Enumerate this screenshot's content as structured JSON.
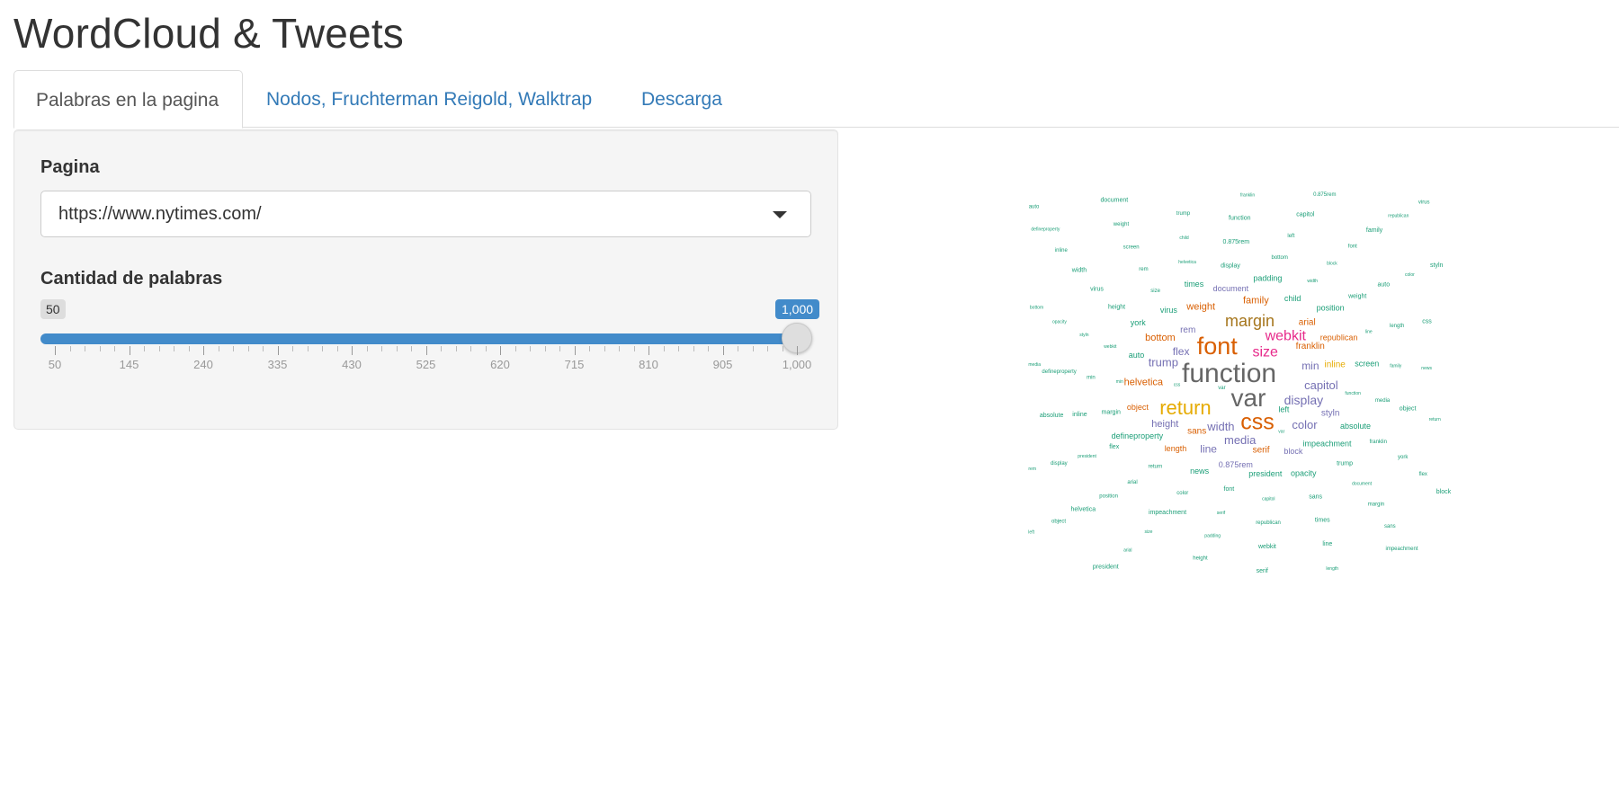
{
  "app": {
    "title": "WordCloud & Tweets"
  },
  "tabs": [
    {
      "label": "Palabras en la pagina"
    },
    {
      "label": "Nodos, Fruchterman Reigold, Walktrap"
    },
    {
      "label": "Descarga"
    }
  ],
  "controls": {
    "pagina": {
      "label": "Pagina",
      "value": "https://www.nytimes.com/"
    },
    "cantidad": {
      "label": "Cantidad de palabras",
      "min": "50",
      "max": "1,000",
      "value": 1000,
      "ticks": [
        "50",
        "145",
        "240",
        "335",
        "430",
        "525",
        "620",
        "715",
        "810",
        "905",
        "1,000"
      ]
    }
  },
  "wordcloud": {
    "words": [
      {
        "text": "function",
        "color": "#666666",
        "size": 30
      },
      {
        "text": "var",
        "color": "#666666",
        "size": 28
      },
      {
        "text": "font",
        "color": "#d95f02",
        "size": 27
      },
      {
        "text": "css",
        "color": "#d95f02",
        "size": 25
      },
      {
        "text": "return",
        "color": "#e6ab02",
        "size": 22
      },
      {
        "text": "margin",
        "color": "#a6761d",
        "size": 18
      },
      {
        "text": "webkit",
        "color": "#e7298a",
        "size": 16
      },
      {
        "text": "size",
        "color": "#e7298a",
        "size": 16
      },
      {
        "text": "display",
        "color": "#7570b3",
        "size": 14
      },
      {
        "text": "width",
        "color": "#7570b3",
        "size": 13
      },
      {
        "text": "media",
        "color": "#7570b3",
        "size": 13
      },
      {
        "text": "trump",
        "color": "#7570b3",
        "size": 13
      },
      {
        "text": "capitol",
        "color": "#7570b3",
        "size": 13
      },
      {
        "text": "color",
        "color": "#7570b3",
        "size": 13
      },
      {
        "text": "flex",
        "color": "#7570b3",
        "size": 12
      },
      {
        "text": "line",
        "color": "#7570b3",
        "size": 12
      },
      {
        "text": "min",
        "color": "#7570b3",
        "size": 12
      },
      {
        "text": "height",
        "color": "#7570b3",
        "size": 11
      },
      {
        "text": "helvetica",
        "color": "#d95f02",
        "size": 11
      },
      {
        "text": "bottom",
        "color": "#d95f02",
        "size": 11
      },
      {
        "text": "weight",
        "color": "#d95f02",
        "size": 11
      },
      {
        "text": "family",
        "color": "#d95f02",
        "size": 11
      },
      {
        "text": "franklin",
        "color": "#d95f02",
        "size": 10
      },
      {
        "text": "sans",
        "color": "#d95f02",
        "size": 10
      },
      {
        "text": "serif",
        "color": "#d95f02",
        "size": 10
      },
      {
        "text": "arial",
        "color": "#d95f02",
        "size": 10
      },
      {
        "text": "inline",
        "color": "#e6ab02",
        "size": 10
      },
      {
        "text": "styln",
        "color": "#7570b3",
        "size": 10
      },
      {
        "text": "rem",
        "color": "#7570b3",
        "size": 10
      },
      {
        "text": "0.875rem",
        "color": "#7570b3",
        "size": 9
      },
      {
        "text": "block",
        "color": "#7570b3",
        "size": 9
      },
      {
        "text": "length",
        "color": "#d95f02",
        "size": 9
      },
      {
        "text": "object",
        "color": "#d95f02",
        "size": 9
      },
      {
        "text": "document",
        "color": "#7570b3",
        "size": 9
      },
      {
        "text": "republican",
        "color": "#d95f02",
        "size": 9
      },
      {
        "text": "impeachment",
        "color": "#1b9e77",
        "size": 9
      },
      {
        "text": "president",
        "color": "#1b9e77",
        "size": 9
      },
      {
        "text": "defineproperty",
        "color": "#1b9e77",
        "size": 9
      },
      {
        "text": "virus",
        "color": "#1b9e77",
        "size": 9
      },
      {
        "text": "child",
        "color": "#1b9e77",
        "size": 9
      },
      {
        "text": "left",
        "color": "#1b9e77",
        "size": 9
      },
      {
        "text": "auto",
        "color": "#1b9e77",
        "size": 9
      },
      {
        "text": "news",
        "color": "#1b9e77",
        "size": 9
      },
      {
        "text": "york",
        "color": "#1b9e77",
        "size": 9
      },
      {
        "text": "times",
        "color": "#1b9e77",
        "size": 9
      },
      {
        "text": "padding",
        "color": "#1b9e77",
        "size": 9
      },
      {
        "text": "position",
        "color": "#1b9e77",
        "size": 9
      },
      {
        "text": "absolute",
        "color": "#1b9e77",
        "size": 9
      },
      {
        "text": "opacity",
        "color": "#1b9e77",
        "size": 9
      },
      {
        "text": "screen",
        "color": "#1b9e77",
        "size": 9
      }
    ],
    "filler_color": "#1b9e77"
  }
}
